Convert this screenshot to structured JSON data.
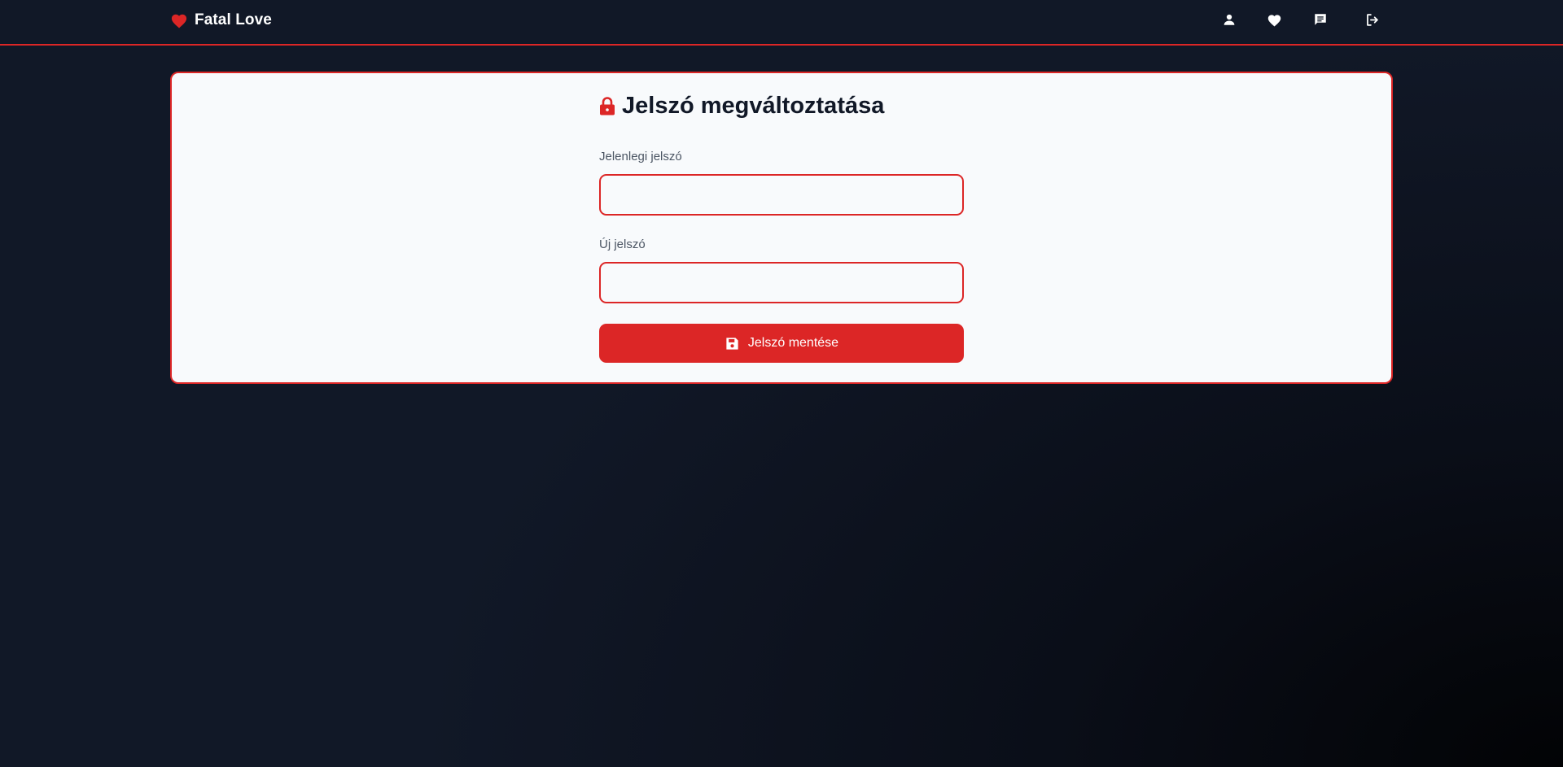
{
  "navbar": {
    "brand": {
      "icon": "heart-icon",
      "name": "Fatal Love"
    },
    "icons": [
      "user-icon",
      "heart-icon",
      "chat-icon",
      "logout-icon"
    ]
  },
  "form": {
    "title_icon": "lock-icon",
    "title": "Jelszó megváltoztatása",
    "current_password": {
      "label": "Jelenlegi jelszó",
      "value": "",
      "placeholder": ""
    },
    "new_password": {
      "label": "Új jelszó",
      "value": "",
      "placeholder": ""
    },
    "save_button": {
      "icon": "save-icon",
      "label": "Jelszó mentése"
    }
  },
  "colors": {
    "accent": "#dc2626",
    "navbar_bg": "#111827",
    "card_bg": "#f8fafc",
    "title_text": "#111827",
    "label_text": "#4b5563"
  }
}
